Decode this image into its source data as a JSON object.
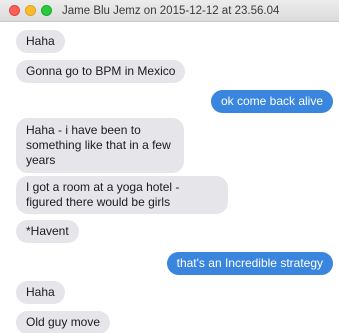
{
  "window": {
    "title": "Jame Blu Jemz on 2015-12-12 at 23.56.04"
  },
  "colors": {
    "incoming_bubble": "#e5e5ea",
    "outgoing_bubble": "#3a85dd",
    "close": "#fc5f57",
    "minimize": "#fdbc2e",
    "maximize": "#29c940"
  },
  "messages": [
    {
      "direction": "incoming",
      "text": "Haha"
    },
    {
      "direction": "incoming",
      "text": "Gonna go to BPM in Mexico"
    },
    {
      "direction": "outgoing",
      "text": "ok come back alive"
    },
    {
      "direction": "incoming",
      "text": "Haha - i have been to something like that in a few years"
    },
    {
      "direction": "incoming",
      "text": "I got a room at a yoga hotel - figured there would be girls"
    },
    {
      "direction": "incoming",
      "text": "*Havent"
    },
    {
      "direction": "outgoing",
      "text": "that's an Incredible strategy"
    },
    {
      "direction": "incoming",
      "text": "Haha"
    },
    {
      "direction": "incoming",
      "text": "Old guy move"
    }
  ]
}
